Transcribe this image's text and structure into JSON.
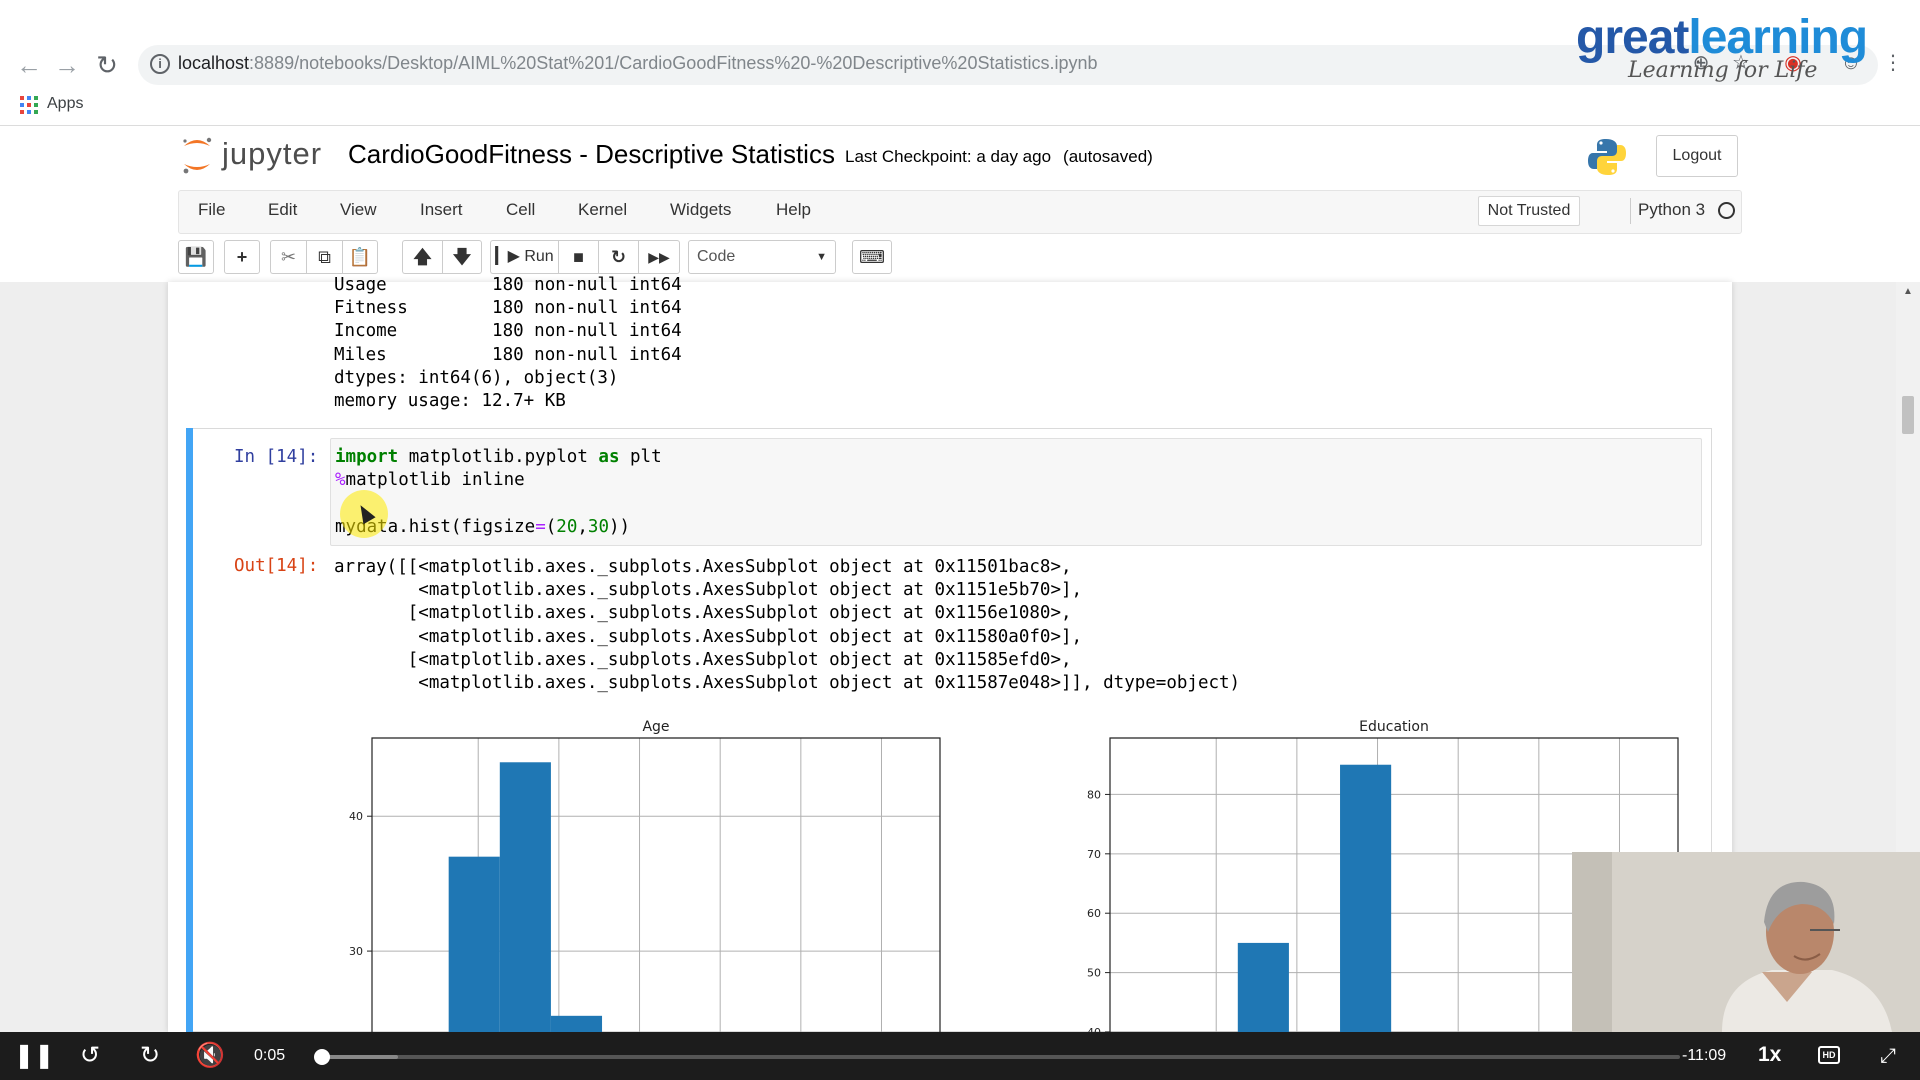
{
  "browser": {
    "url_host": "localhost",
    "url_path": ":8889/notebooks/Desktop/AIML%20Stat%201/CardioGoodFitness%20-%20Descriptive%20Statistics.ipynb",
    "bookmarks_apps_label": "Apps",
    "nav_back_icon": "arrow-left-icon",
    "nav_forward_icon": "arrow-right-icon",
    "reload_icon": "reload-icon"
  },
  "overlay_logo": {
    "brand_part1": "great",
    "brand_part2": "learning",
    "tagline": "Learning for Life"
  },
  "jupyter": {
    "logo_text": "jupyter",
    "notebook_title": "CardioGoodFitness - Descriptive Statistics",
    "checkpoint": "Last Checkpoint: a day ago",
    "autosave": "(autosaved)",
    "logout_label": "Logout",
    "menu": [
      "File",
      "Edit",
      "View",
      "Insert",
      "Cell",
      "Kernel",
      "Widgets",
      "Help"
    ],
    "trust_label": "Not Trusted",
    "kernel_name": "Python 3",
    "toolbar": {
      "run_label": "Run",
      "cell_type": "Code"
    }
  },
  "notebook": {
    "previous_output_lines": [
      "Usage          180 non-null int64",
      "Fitness        180 non-null int64",
      "Income         180 non-null int64",
      "Miles          180 non-null int64",
      "dtypes: int64(6), object(3)",
      "memory usage: 12.7+ KB"
    ],
    "cell": {
      "in_prompt": "In [14]:",
      "code_lines": [
        "import matplotlib.pyplot as plt",
        "%matplotlib inline",
        "",
        "mydata.hist(figsize=(20,30))"
      ],
      "out_prompt": "Out[14]:",
      "output_lines": [
        "array([[<matplotlib.axes._subplots.AxesSubplot object at 0x11501bac8>,",
        "        <matplotlib.axes._subplots.AxesSubplot object at 0x1151e5b70>],",
        "       [<matplotlib.axes._subplots.AxesSubplot object at 0x1156e1080>,",
        "        <matplotlib.axes._subplots.AxesSubplot object at 0x11580a0f0>],",
        "       [<matplotlib.axes._subplots.AxesSubplot object at 0x11585efd0>,",
        "        <matplotlib.axes._subplots.AxesSubplot object at 0x11587e048>]], dtype=object)"
      ]
    }
  },
  "chart_data": [
    {
      "type": "bar",
      "title": "Age",
      "xlabel": "",
      "ylabel": "",
      "ylim_visible": [
        24,
        45.8
      ],
      "yticks": [
        30,
        40
      ],
      "grid": true,
      "bar_color": "#1f77b4",
      "bins": [
        {
          "x0": 0.135,
          "x1": 0.225,
          "value": 37
        },
        {
          "x0": 0.225,
          "x1": 0.315,
          "value": 44
        },
        {
          "x0": 0.315,
          "x1": 0.405,
          "value": 25.2
        }
      ]
    },
    {
      "type": "bar",
      "title": "Education",
      "xlabel": "",
      "ylabel": "",
      "ylim_visible": [
        40,
        89.5
      ],
      "yticks": [
        40,
        50,
        60,
        70,
        80
      ],
      "grid": true,
      "bar_color": "#1f77b4",
      "bins": [
        {
          "x0": 0.225,
          "x1": 0.315,
          "value": 55
        },
        {
          "x0": 0.405,
          "x1": 0.495,
          "value": 85
        }
      ]
    }
  ],
  "video": {
    "elapsed": "0:05",
    "remaining": "-11:09",
    "speed": "1x",
    "hd_label": "HD",
    "progress_fraction": 0.005
  }
}
